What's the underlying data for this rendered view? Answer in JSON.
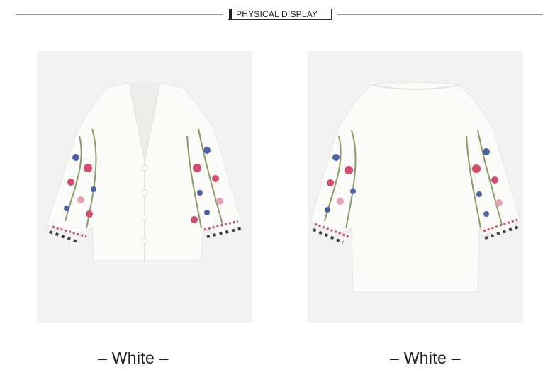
{
  "header": {
    "title": "PHYSICAL DISPLAY"
  },
  "products": [
    {
      "view": "front",
      "caption": "– White –"
    },
    {
      "view": "back",
      "caption": "– White –"
    }
  ],
  "colors": {
    "blouse": "#fbfbf9",
    "background": "#f2f2f2",
    "embroidery_red": "#d64b6a",
    "embroidery_blue": "#4a63a8",
    "embroidery_green": "#8c9a63"
  }
}
